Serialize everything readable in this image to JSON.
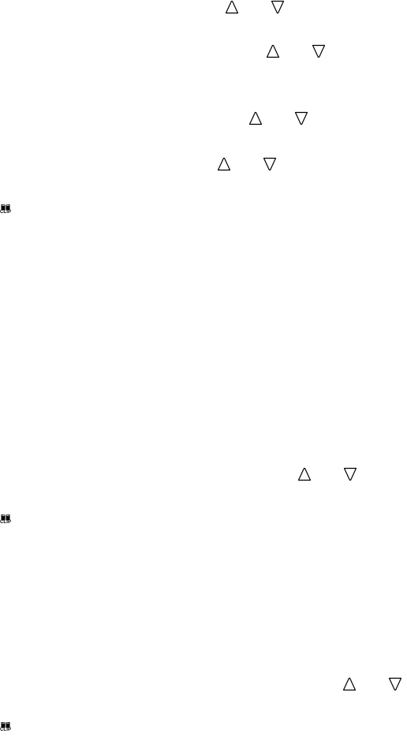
{
  "vote_controls": [
    {
      "up_icon": "upvote-arrow-icon",
      "down_icon": "downvote-arrow-icon"
    },
    {
      "up_icon": "upvote-arrow-icon",
      "down_icon": "downvote-arrow-icon"
    },
    {
      "up_icon": "upvote-arrow-icon",
      "down_icon": "downvote-arrow-icon"
    },
    {
      "up_icon": "upvote-arrow-icon",
      "down_icon": "downvote-arrow-icon"
    },
    {
      "up_icon": "upvote-arrow-icon",
      "down_icon": "downvote-arrow-icon"
    },
    {
      "up_icon": "upvote-arrow-icon",
      "down_icon": "downvote-arrow-icon"
    }
  ],
  "clip_buttons": [
    {
      "label": "CLIP",
      "icon": "book-icon"
    },
    {
      "label": "CLIP",
      "icon": "book-icon"
    },
    {
      "label": "CLIP",
      "icon": "book-icon"
    }
  ]
}
